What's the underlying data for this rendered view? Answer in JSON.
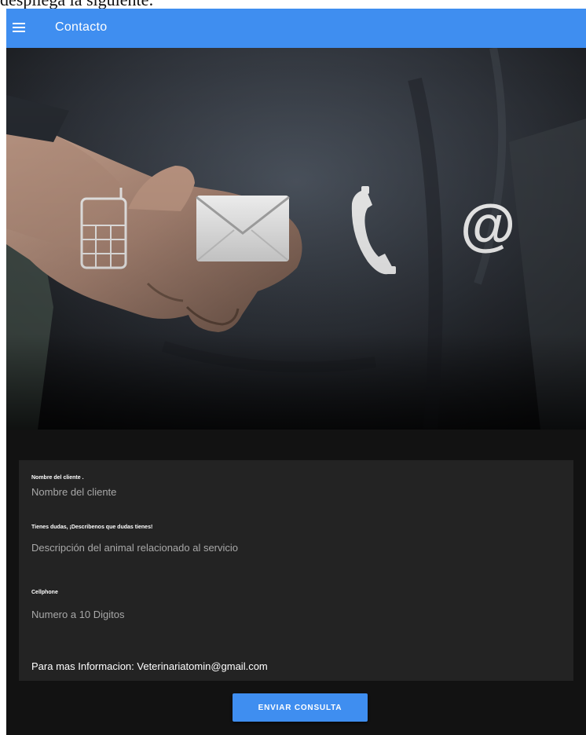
{
  "page": {
    "caption": "despliega la siguiente:"
  },
  "toolbar": {
    "menu_icon": "hamburger-menu-icon",
    "title": "Contacto"
  },
  "hero": {
    "icons": [
      "mobile-phone-icon",
      "envelope-icon",
      "telephone-handset-icon",
      "at-sign-icon"
    ],
    "at_symbol": "@"
  },
  "form": {
    "name": {
      "label": "Nombre del cliente .",
      "placeholder": "Nombre del cliente"
    },
    "doubts": {
      "label": "Tienes dudas, ¡Describenos que dudas tienes!",
      "placeholder": "Descripción del animal relacionado al servicio"
    },
    "phone": {
      "label": "Cellphone",
      "placeholder": "Numero a 10 Digitos"
    },
    "info": "Para mas Informacion: Veterinariatomin@gmail.com"
  },
  "actions": {
    "submit_label": "ENVIAR CONSULTA"
  },
  "colors": {
    "primary": "#3f8ef0",
    "background": "#121212",
    "card": "#232323"
  }
}
